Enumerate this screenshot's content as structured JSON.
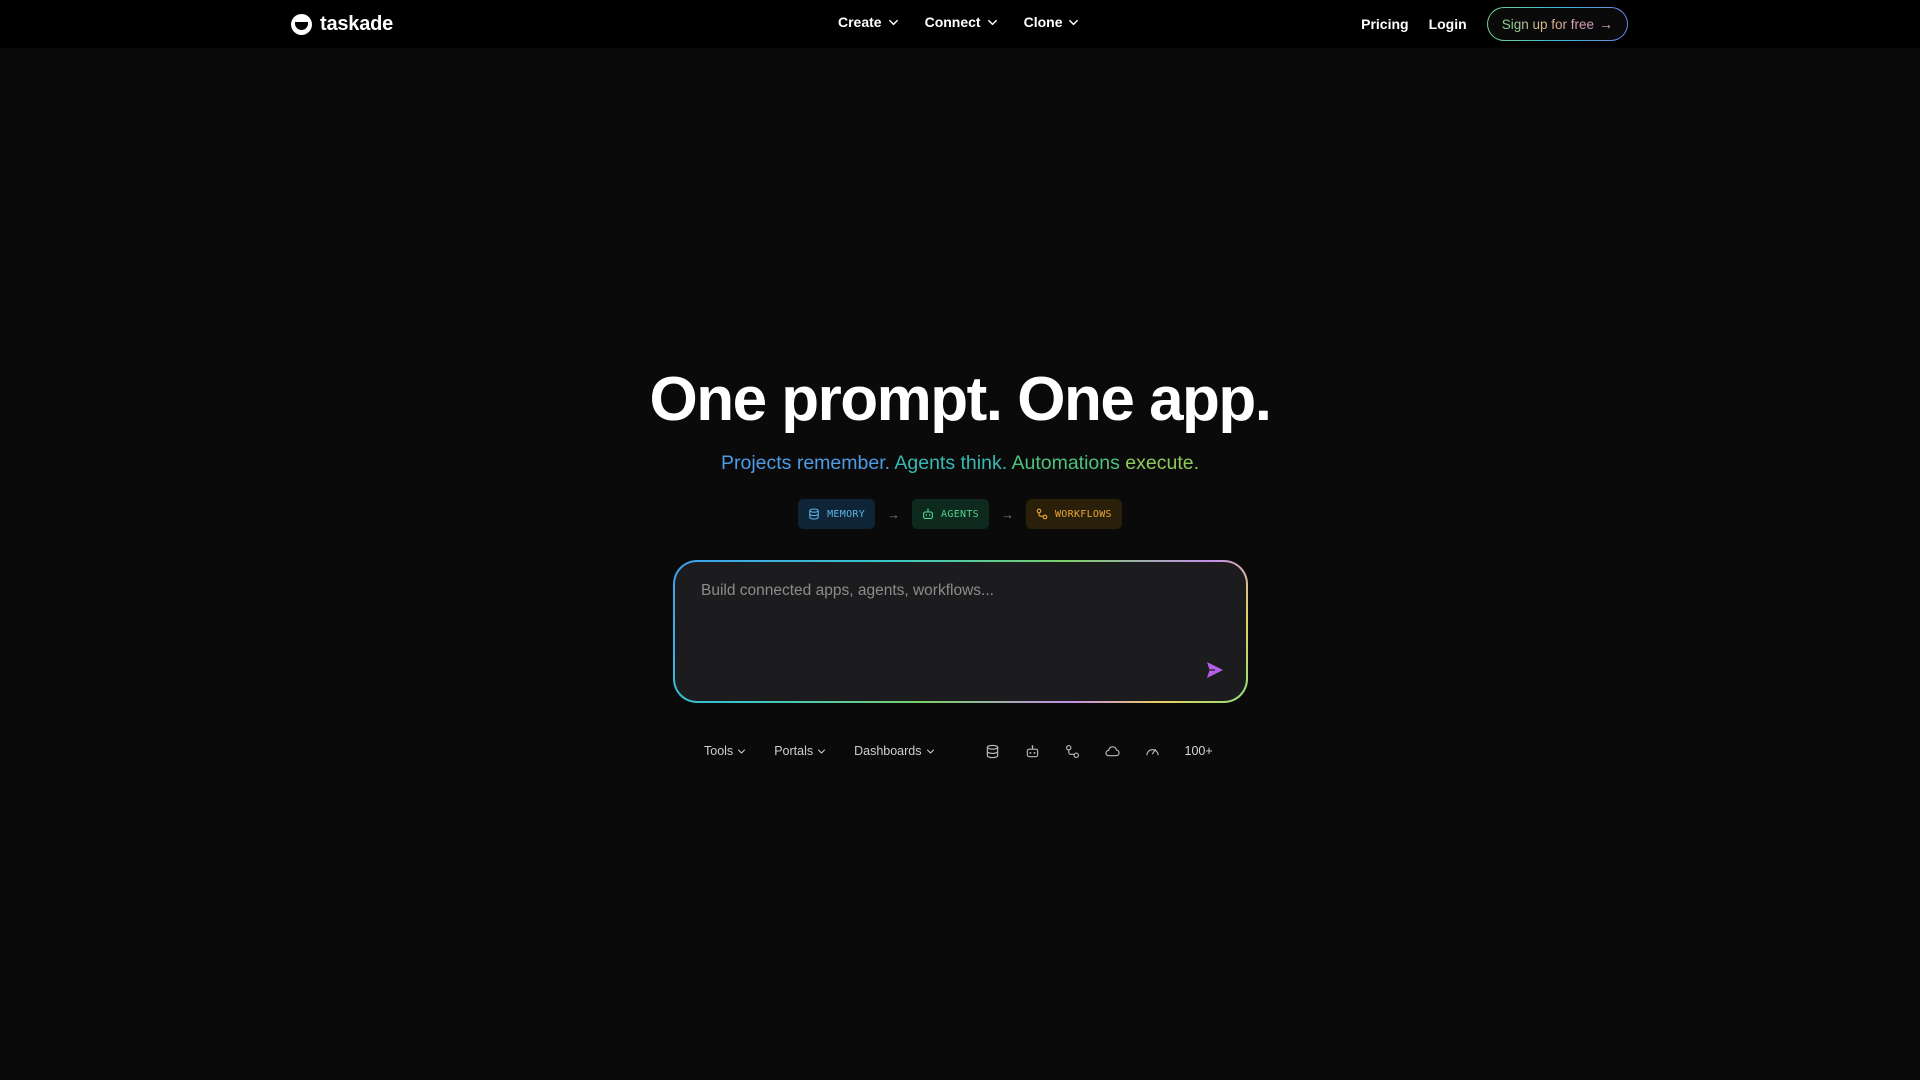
{
  "nav": {
    "logo_text": "taskade",
    "menu": [
      {
        "label": "Create"
      },
      {
        "label": "Connect"
      },
      {
        "label": "Clone"
      }
    ],
    "pricing": "Pricing",
    "login": "Login",
    "signup": "Sign up for free",
    "signup_arrow": "→"
  },
  "hero": {
    "title": "One prompt. One app.",
    "subtitle": {
      "part1": "Projects remember.",
      "part2": "Agents think.",
      "part3": "Automations",
      "part4": "execute."
    },
    "pipeline": {
      "memory": "MEMORY",
      "agents": "AGENTS",
      "workflows": "WORKFLOWS",
      "arrow": "→"
    }
  },
  "prompt": {
    "placeholder": "Build connected apps, agents, workflows...",
    "value": ""
  },
  "toolbar": {
    "tools": "Tools",
    "portals": "Portals",
    "dashboards": "Dashboards",
    "more": "100+"
  },
  "colors": {
    "background": "#0a0a0a",
    "nav": "#000000",
    "prompt_bg": "#1c1c1e",
    "send_icon": "#b45ee8",
    "memory": "#5ab4e8",
    "agents": "#4fd18c",
    "workflows": "#e8a83a"
  },
  "icons": {
    "menu_chevron": "chevron-down-icon",
    "memory": "database-icon",
    "agents": "robot-icon",
    "workflows": "workflow-icon",
    "send": "send-icon",
    "toolbar": [
      "database-icon",
      "robot-icon",
      "workflow-icon",
      "cloud-icon",
      "gauge-icon"
    ]
  }
}
